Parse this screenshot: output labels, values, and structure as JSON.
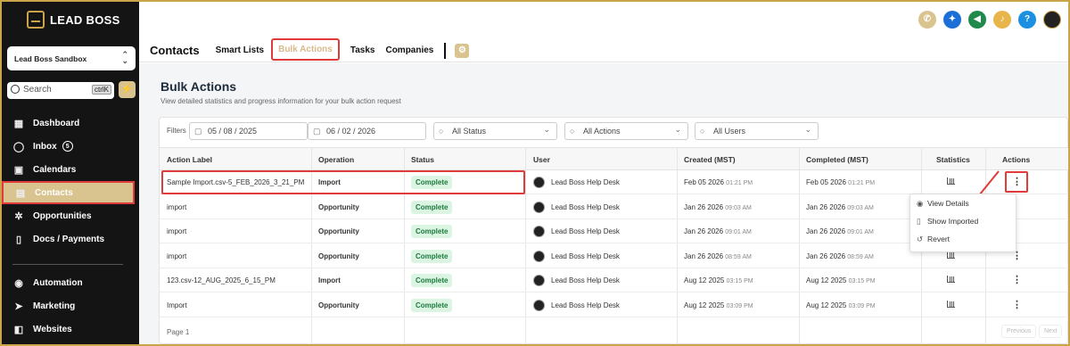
{
  "brand": {
    "name": "LEAD BOSS"
  },
  "account": {
    "name": "Lead Boss Sandbox"
  },
  "search": {
    "placeholder": "Search",
    "shortcut": "ctrlK"
  },
  "sidebar": {
    "items": [
      {
        "label": "Dashboard",
        "icon": "grid-icon"
      },
      {
        "label": "Inbox",
        "icon": "chat-icon",
        "badge": "5"
      },
      {
        "label": "Calendars",
        "icon": "calendar-icon"
      },
      {
        "label": "Contacts",
        "icon": "contacts-icon"
      },
      {
        "label": "Opportunities",
        "icon": "opportunities-icon"
      },
      {
        "label": "Docs / Payments",
        "icon": "document-icon"
      }
    ],
    "items2": [
      {
        "label": "Automation",
        "icon": "automation-icon"
      },
      {
        "label": "Marketing",
        "icon": "send-icon"
      },
      {
        "label": "Websites",
        "icon": "website-icon"
      }
    ]
  },
  "header": {
    "title": "Contacts",
    "tabs": [
      "Smart Lists",
      "Bulk Actions",
      "Tasks",
      "Companies"
    ],
    "active_tab": "Bulk Actions"
  },
  "page": {
    "title": "Bulk Actions",
    "subtitle": "View detailed statistics and progress information for your bulk action request"
  },
  "filters": {
    "label": "Filters",
    "date_from": "05 / 08 / 2025",
    "date_to": "06 / 02 / 2026",
    "status": "All Status",
    "actions": "All Actions",
    "users": "All Users"
  },
  "table": {
    "columns": [
      "Action Label",
      "Operation",
      "Status",
      "User",
      "Created (MST)",
      "Completed (MST)",
      "Statistics",
      "Actions"
    ],
    "rows": [
      {
        "label": "Sample Import.csv-5_FEB_2026_3_21_PM",
        "operation": "Import",
        "status": "Complete",
        "user": "Lead Boss Help Desk",
        "created": "Feb 05 2026",
        "created_time": "01:21 PM",
        "completed": "Feb 05 2026",
        "completed_time": "01:21 PM"
      },
      {
        "label": "import",
        "operation": "Opportunity",
        "status": "Complete",
        "user": "Lead Boss Help Desk",
        "created": "Jan 26 2026",
        "created_time": "09:03 AM",
        "completed": "Jan 26 2026",
        "completed_time": "09:03 AM"
      },
      {
        "label": "import",
        "operation": "Opportunity",
        "status": "Complete",
        "user": "Lead Boss Help Desk",
        "created": "Jan 26 2026",
        "created_time": "09:01 AM",
        "completed": "Jan 26 2026",
        "completed_time": "09:01 AM"
      },
      {
        "label": "import",
        "operation": "Opportunity",
        "status": "Complete",
        "user": "Lead Boss Help Desk",
        "created": "Jan 26 2026",
        "created_time": "08:59 AM",
        "completed": "Jan 26 2026",
        "completed_time": "08:59 AM"
      },
      {
        "label": "123.csv-12_AUG_2025_6_15_PM",
        "operation": "Import",
        "status": "Complete",
        "user": "Lead Boss Help Desk",
        "created": "Aug 12 2025",
        "created_time": "03:15 PM",
        "completed": "Aug 12 2025",
        "completed_time": "03:15 PM"
      },
      {
        "label": "Import",
        "operation": "Opportunity",
        "status": "Complete",
        "user": "Lead Boss Help Desk",
        "created": "Aug 12 2025",
        "created_time": "03:09 PM",
        "completed": "Aug 12 2025",
        "completed_time": "03:09 PM"
      }
    ],
    "footer": "Page 1",
    "prev": "Previous",
    "next": "Next"
  },
  "menu": {
    "items": [
      "View Details",
      "Show Imported",
      "Revert"
    ]
  },
  "colors": {
    "accent": "#d9c38f",
    "highlight": "#e03a3a",
    "sidebar": "#141414",
    "complete_bg": "#dcf5e3",
    "complete_text": "#1b7a3c"
  }
}
